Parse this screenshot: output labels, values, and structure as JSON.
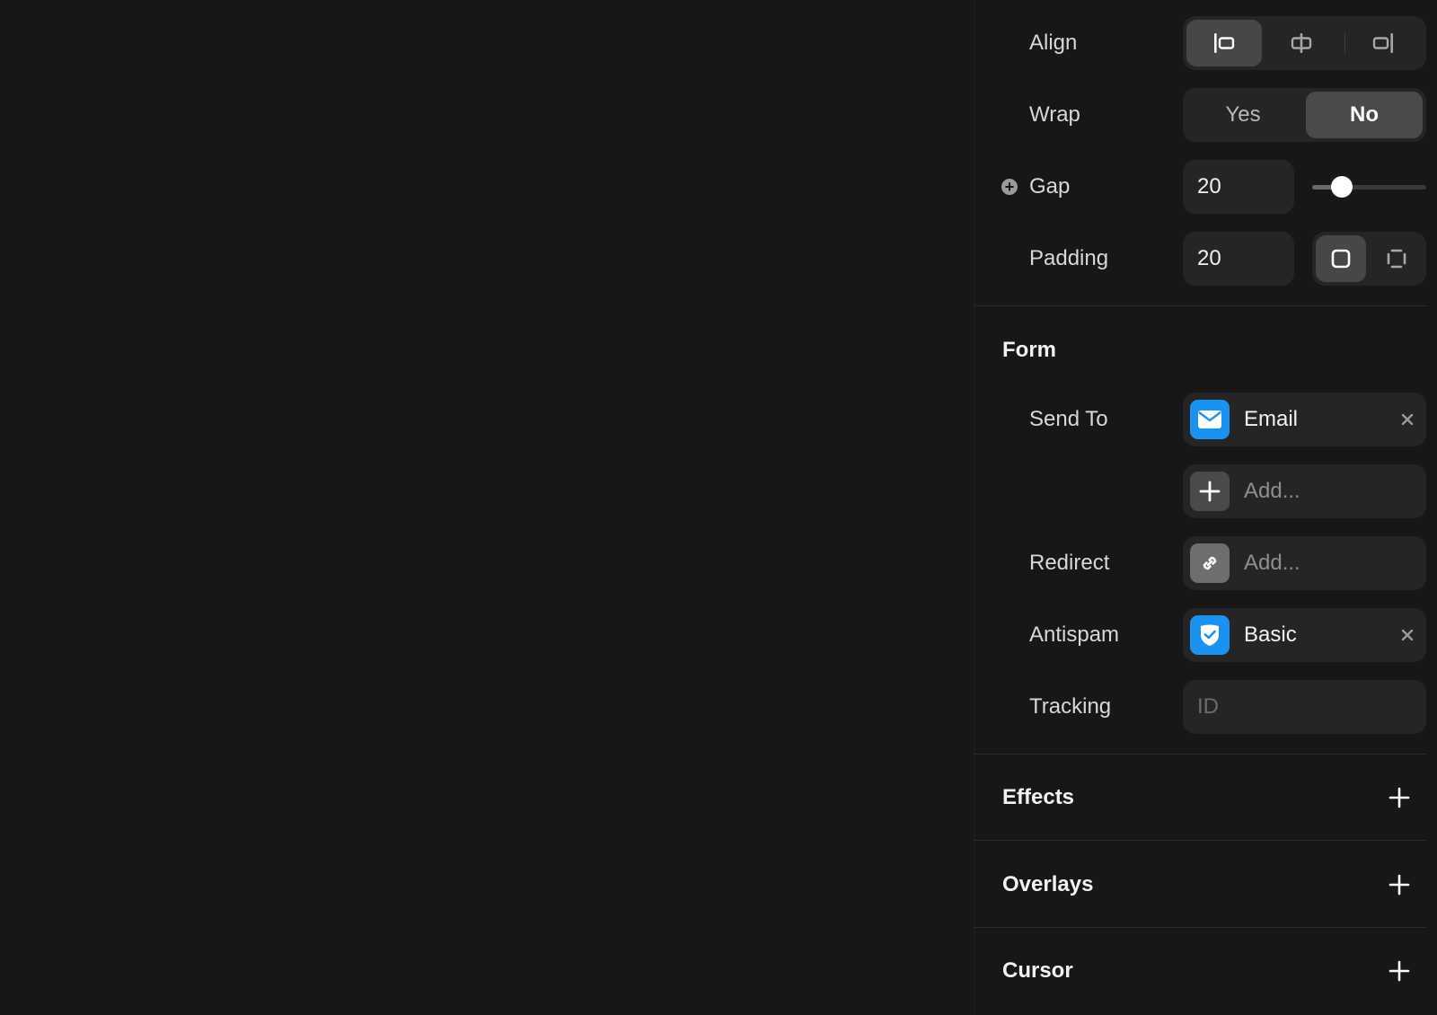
{
  "layout": {
    "align_label": "Align",
    "align_options": [
      "left",
      "center",
      "right"
    ],
    "align_selected": "left",
    "wrap_label": "Wrap",
    "wrap_yes": "Yes",
    "wrap_no": "No",
    "wrap_selected": "No",
    "gap_label": "Gap",
    "gap_value": "20",
    "gap_slider_fraction": 0.26,
    "padding_label": "Padding",
    "padding_value": "20",
    "padding_mode": "uniform"
  },
  "form": {
    "title": "Form",
    "send_to_label": "Send To",
    "send_to_value": "Email",
    "send_to_icon": "mail-icon",
    "add_placeholder": "Add...",
    "redirect_label": "Redirect",
    "redirect_placeholder": "Add...",
    "redirect_icon": "link-icon",
    "antispam_label": "Antispam",
    "antispam_value": "Basic",
    "antispam_icon": "shield-check-icon",
    "tracking_label": "Tracking",
    "tracking_placeholder": "ID"
  },
  "sections": {
    "effects": "Effects",
    "overlays": "Overlays",
    "cursor": "Cursor"
  },
  "colors": {
    "background": "#171717",
    "control_bg": "#252525",
    "active_segment": "#474747",
    "accent_blue": "#1a93f0"
  }
}
